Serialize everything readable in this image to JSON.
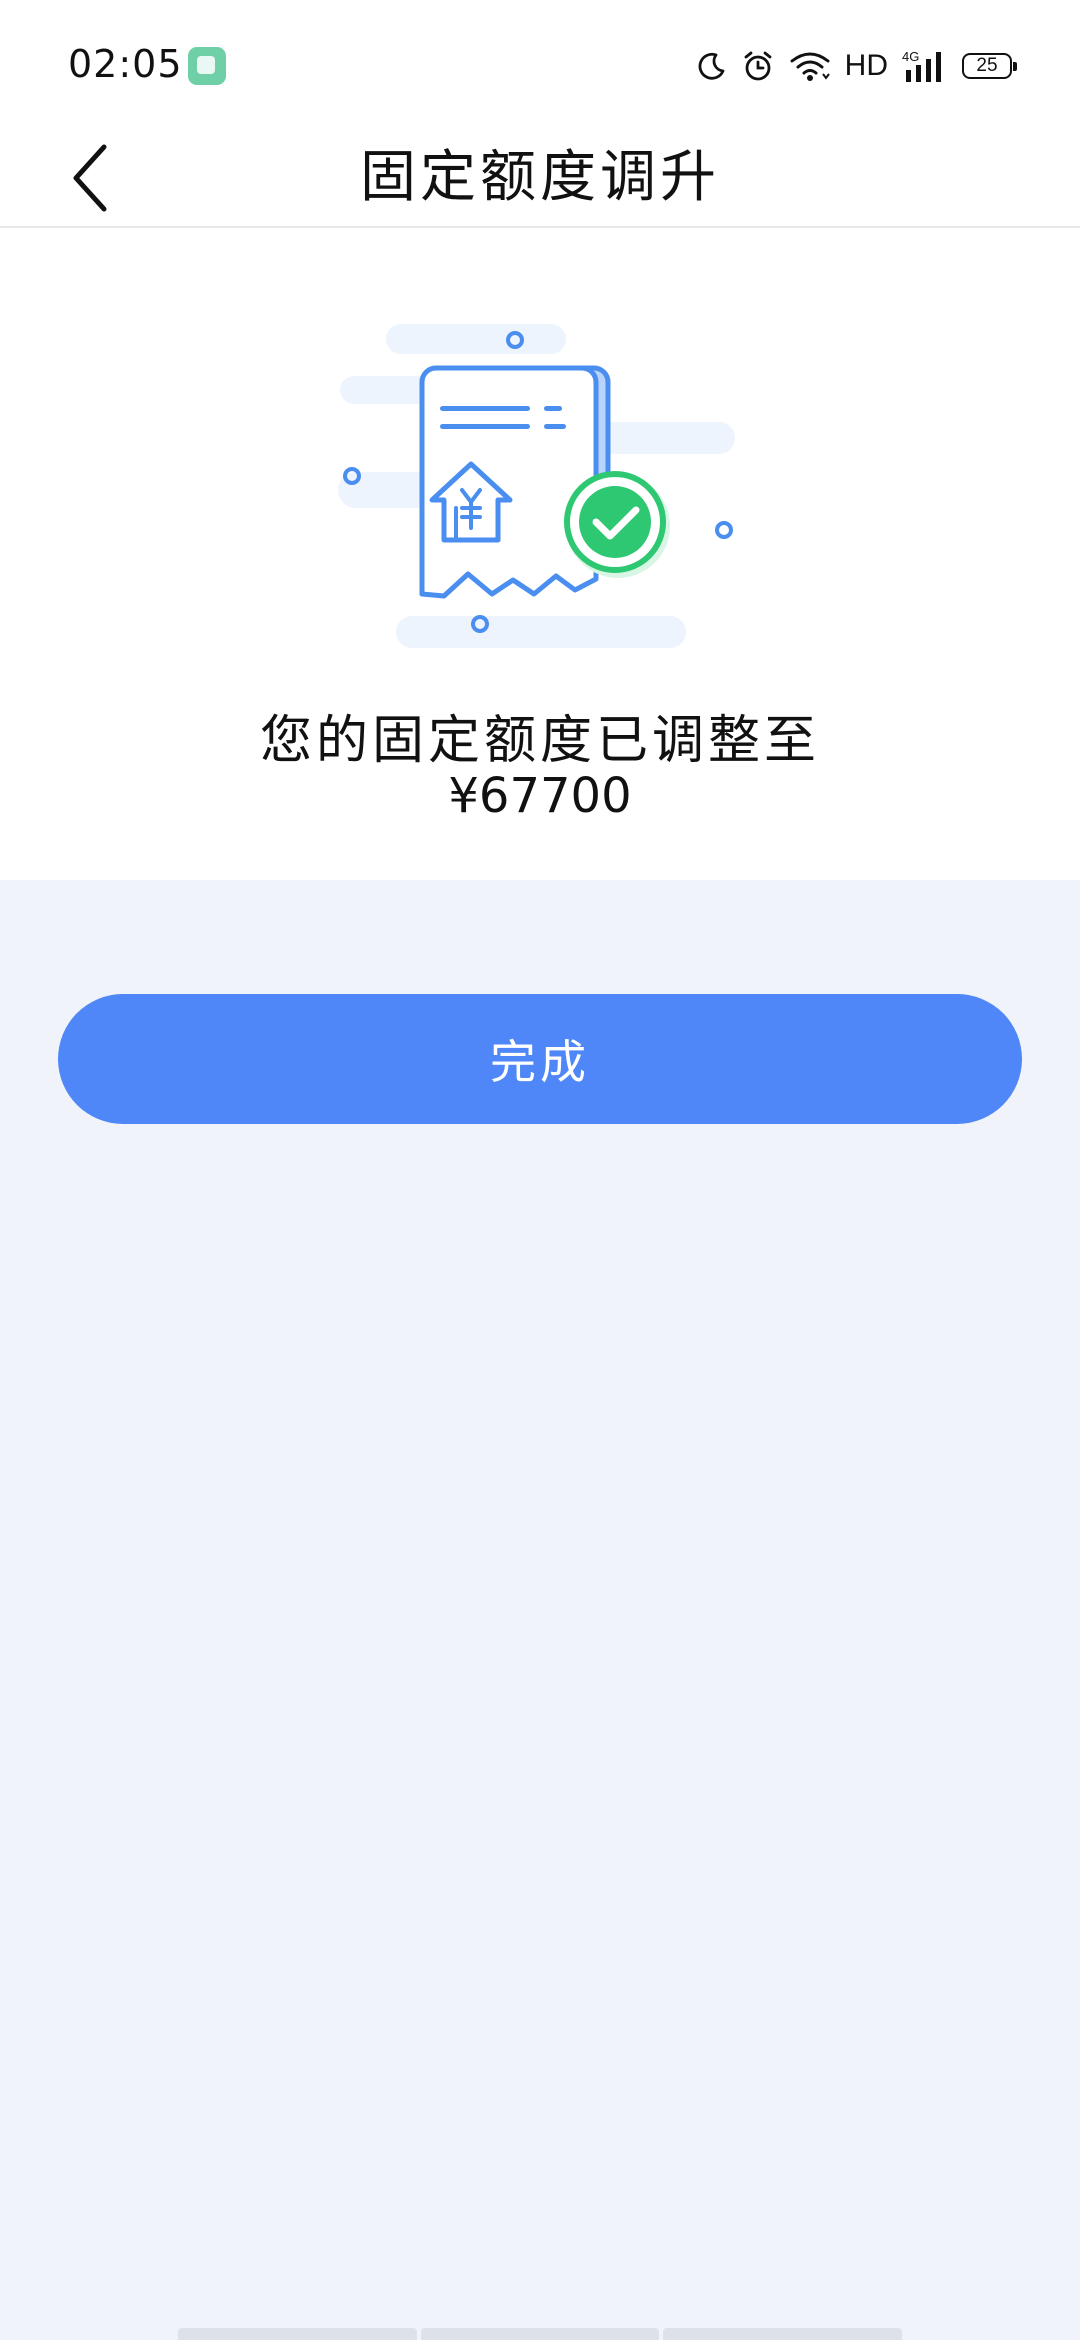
{
  "status_bar": {
    "time": "02:05",
    "network": "HD",
    "signal_label": "4G",
    "battery": "25",
    "icons": [
      "app-notification-icon",
      "moon-icon",
      "alarm-icon",
      "wifi-icon",
      "signal-icon",
      "battery-icon"
    ]
  },
  "nav": {
    "back_icon": "chevron-left-icon",
    "title": "固定额度调升"
  },
  "result": {
    "illustration": "receipt-with-check-icon",
    "message": "您的固定额度已调整至",
    "amount": "¥67700"
  },
  "actions": {
    "done_label": "完成"
  },
  "colors": {
    "primary": "#4f87f8",
    "success": "#2ec872",
    "background": "#f0f3f9",
    "illustration_blue": "#4a8ef0"
  }
}
